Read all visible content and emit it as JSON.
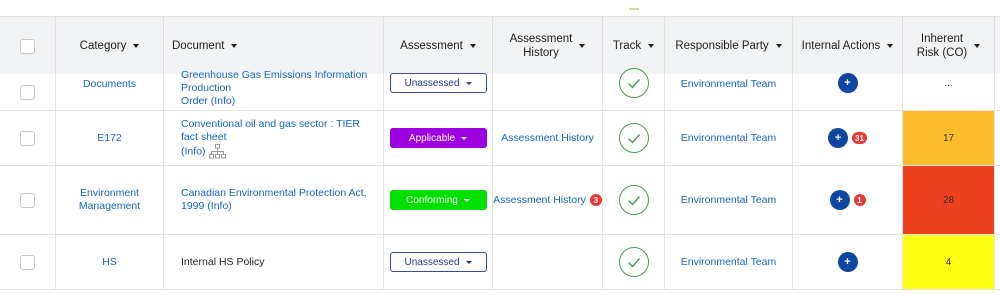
{
  "colors": {
    "header_bg": "#f1f2f3",
    "link": "#1565c0",
    "assessment_unassessed_border": "#3949ab",
    "assessment_applicable": "#9c00e0",
    "assessment_conforming": "#00e000",
    "track_check": "#43a047",
    "action_button": "#0d47a1",
    "badge": "#e53935"
  },
  "columns": {
    "category": "Category",
    "document": "Document",
    "assessment": "Assessment",
    "assessment_history_1": "Assessment",
    "assessment_history_2": "History",
    "track": "Track",
    "responsible_party": "Responsible Party",
    "internal_actions": "Internal Actions",
    "inherent_risk_1": "Inherent",
    "inherent_risk_2": "Risk (CO)"
  },
  "rows": [
    {
      "category": "Documents",
      "document_line1": "Greenhouse Gas Emissions Information Production",
      "document_line2": "Order (Info)",
      "assessment": "Unassessed",
      "assessment_style": "outline",
      "history": "",
      "history_badge": "",
      "responsible_party": "Environmental Team",
      "action_badge": "",
      "risk": "...",
      "risk_color": "#ffffff"
    },
    {
      "category": "E172",
      "document_line1": "Conventional oil and gas sector : TIER fact sheet",
      "document_line2": "(Info)",
      "assessment": "Applicable",
      "assessment_style": "purple",
      "history": "Assessment History",
      "history_badge": "",
      "responsible_party": "Environmental Team",
      "action_badge": "31",
      "risk": "17",
      "risk_color": "#fbbc2c"
    },
    {
      "category_line1": "Environment",
      "category_line2": "Management",
      "document_line1": "Canadian Environmental Protection Act, 1999 (Info)",
      "assessment": "Conforming",
      "assessment_style": "green",
      "history": "Assessment History",
      "history_badge": "3",
      "responsible_party": "Environmental Team",
      "action_badge": "1",
      "risk": "28",
      "risk_color": "#ee4120"
    },
    {
      "category": "HS",
      "document_line1": "Internal HS Policy",
      "assessment": "Unassessed",
      "assessment_style": "outline",
      "history": "",
      "history_badge": "",
      "responsible_party": "Environmental Team",
      "action_badge": "",
      "risk": "4",
      "risk_color": "#ffff14"
    }
  ],
  "icons": {
    "track": "check-circle-icon",
    "action": "plus-icon",
    "hierarchy": "hierarchy-icon"
  },
  "plus_symbol": "+"
}
